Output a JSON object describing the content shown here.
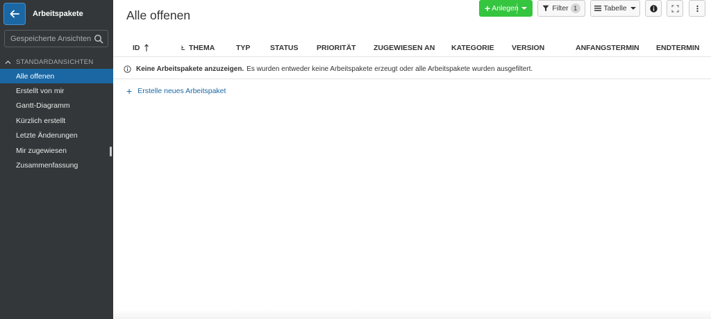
{
  "sidebar": {
    "title": "Arbeitspakete",
    "search_placeholder": "Gespeicherte Ansichten ...",
    "section": "STANDARDANSICHTEN",
    "items": [
      {
        "label": "Alle offenen",
        "active": true
      },
      {
        "label": "Erstellt von mir"
      },
      {
        "label": "Gantt-Diagramm"
      },
      {
        "label": "Kürzlich erstellt"
      },
      {
        "label": "Letzte Änderungen"
      },
      {
        "label": "Mir zugewiesen"
      },
      {
        "label": "Zusammenfassung"
      }
    ]
  },
  "header": {
    "title": "Alle offenen"
  },
  "toolbar": {
    "create_label": "Anlegen",
    "filter_label": "Filter",
    "filter_count": "1",
    "table_label": "Tabelle"
  },
  "table": {
    "columns": [
      "ID",
      "THEMA",
      "TYP",
      "STATUS",
      "PRIORITÄT",
      "ZUGEWIESEN AN",
      "KATEGORIE",
      "VERSION",
      "ANFANGSTERMIN",
      "ENDTERMIN"
    ]
  },
  "notice": {
    "bold": "Keine Arbeitspakete anzuzeigen.",
    "text": "Es wurden entweder keine Arbeitspakete erzeugt oder alle Arbeitspakete wurden ausgefiltert."
  },
  "create_link": "Erstelle neues Arbeitspaket",
  "colors": {
    "sidebar_bg": "#333739",
    "accent": "#1a67a3",
    "create_button": "#35c53f"
  }
}
